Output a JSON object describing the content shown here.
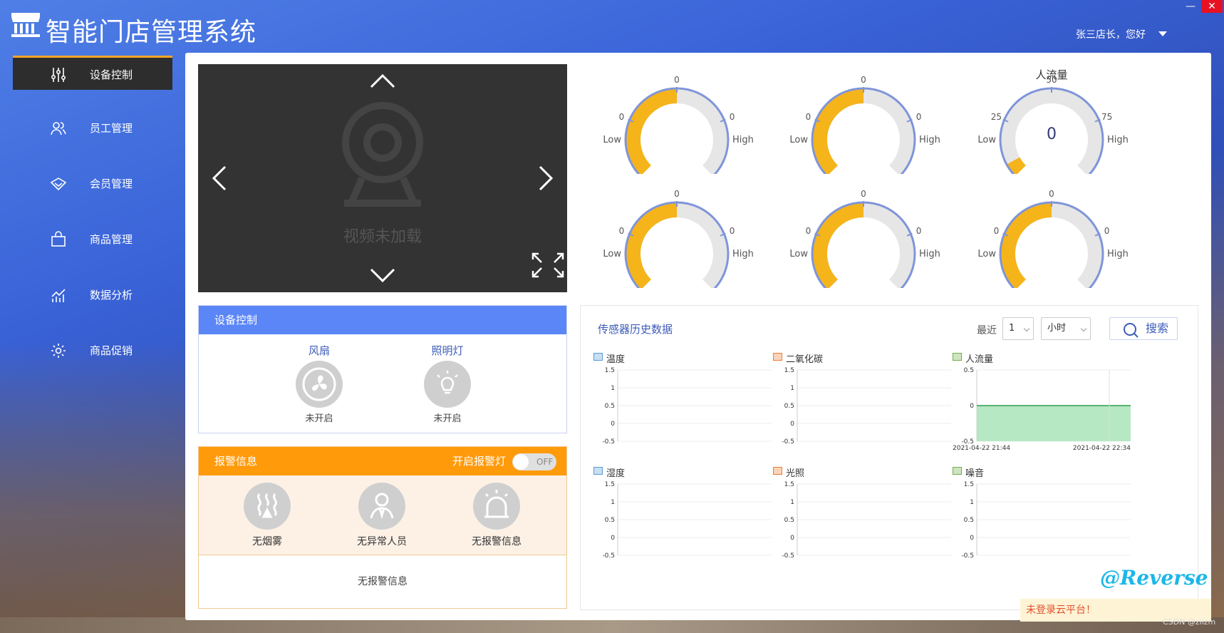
{
  "app": {
    "title": "智能门店管理系统",
    "user_greeting": "张三店长，您好",
    "minimize": "—",
    "close": "✕"
  },
  "sidebar": {
    "items": [
      {
        "label": "设备控制",
        "icon": "sliders-icon",
        "active": true
      },
      {
        "label": "员工管理",
        "icon": "users-icon"
      },
      {
        "label": "会员管理",
        "icon": "diamond-icon"
      },
      {
        "label": "商品管理",
        "icon": "shopping-bag-icon"
      },
      {
        "label": "数据分析",
        "icon": "chart-icon"
      },
      {
        "label": "商品促销",
        "icon": "settings-icon"
      }
    ]
  },
  "video": {
    "status": "视频未加载"
  },
  "gauges": [
    {
      "title": "",
      "ticks": [
        "0",
        "0",
        "0"
      ],
      "low": "Low",
      "high": "High",
      "value_fraction": 0.5,
      "value_text": ""
    },
    {
      "title": "",
      "ticks": [
        "0",
        "0",
        "0"
      ],
      "low": "Low",
      "high": "High",
      "value_fraction": 0.5,
      "value_text": ""
    },
    {
      "title": "人流量",
      "ticks": [
        "25",
        "50",
        "75"
      ],
      "low": "Low",
      "high": "High",
      "value_fraction": 0.06,
      "value_text": "0"
    },
    {
      "title": "",
      "ticks": [
        "0",
        "0",
        "0"
      ],
      "low": "Low",
      "high": "High",
      "value_fraction": 0.5,
      "value_text": ""
    },
    {
      "title": "",
      "ticks": [
        "0",
        "0",
        "0"
      ],
      "low": "Low",
      "high": "High",
      "value_fraction": 0.5,
      "value_text": ""
    },
    {
      "title": "",
      "ticks": [
        "0",
        "0",
        "0"
      ],
      "low": "Low",
      "high": "High",
      "value_fraction": 0.5,
      "value_text": ""
    }
  ],
  "device_control": {
    "title": "设备控制",
    "items": [
      {
        "name": "风扇",
        "status": "未开启",
        "icon": "fan-icon"
      },
      {
        "name": "照明灯",
        "status": "未开启",
        "icon": "light-bulb-icon"
      }
    ]
  },
  "alarm": {
    "title": "报警信息",
    "switch_label": "开启报警灯",
    "switch_state": "OFF",
    "items": [
      {
        "status": "无烟雾",
        "icon": "smoke-icon"
      },
      {
        "status": "无异常人员",
        "icon": "person-icon"
      },
      {
        "status": "无报警信息",
        "icon": "alarm-lamp-icon"
      }
    ],
    "message": "无报警信息"
  },
  "sensor": {
    "title": "传感器历史数据",
    "recent_label": "最近",
    "count_value": "1",
    "unit_value": "小时",
    "search_label": "搜索",
    "charts": [
      {
        "name": "温度",
        "color": "#5b9bd5",
        "yticks": [
          "1.5",
          "1",
          "0.5",
          "0",
          "-0.5"
        ],
        "xlabels": [],
        "filled": false
      },
      {
        "name": "二氧化碳",
        "color": "#ed7d31",
        "yticks": [
          "1.5",
          "1",
          "0.5",
          "0",
          "-0.5"
        ],
        "xlabels": [],
        "filled": false
      },
      {
        "name": "人流量",
        "color": "#70ad47",
        "yticks": [
          "0.5",
          "0",
          "-0.5"
        ],
        "xlabels": [
          "2021-04-22 21:44",
          "2021-04-22 22:34"
        ],
        "filled": true
      },
      {
        "name": "湿度",
        "color": "#5b9bd5",
        "yticks": [
          "1.5",
          "1",
          "0.5",
          "0",
          "-0.5"
        ],
        "xlabels": [],
        "filled": false
      },
      {
        "name": "光照",
        "color": "#ed7d31",
        "yticks": [
          "1.5",
          "1",
          "0.5",
          "0",
          "-0.5"
        ],
        "xlabels": [],
        "filled": false
      },
      {
        "name": "噪音",
        "color": "#70ad47",
        "yticks": [
          "1.5",
          "1",
          "0.5",
          "0",
          "-0.5"
        ],
        "xlabels": [],
        "filled": false
      }
    ]
  },
  "footer": {
    "watermark": "@Reverse",
    "cloud_status": "未登录云平台！",
    "credit": "CSDN @ziizm"
  }
}
